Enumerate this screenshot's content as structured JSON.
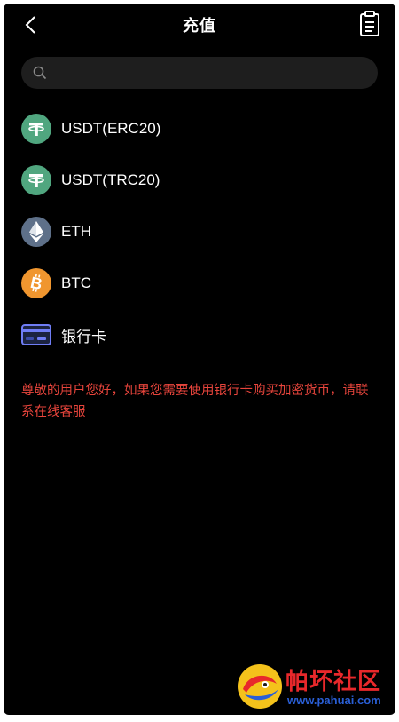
{
  "header": {
    "title": "充值",
    "back_icon": "chevron-left-icon",
    "record_icon": "clipboard-list-icon"
  },
  "search": {
    "value": "",
    "placeholder": ""
  },
  "list": {
    "items": [
      {
        "label": "USDT(ERC20)",
        "icon": "tether-icon",
        "color": "#50a67f"
      },
      {
        "label": "USDT(TRC20)",
        "icon": "tether-icon",
        "color": "#50a67f"
      },
      {
        "label": "ETH",
        "icon": "ethereum-icon",
        "color": "#5e7089"
      },
      {
        "label": "BTC",
        "icon": "bitcoin-icon",
        "color": "#f0962f"
      },
      {
        "label": "银行卡",
        "icon": "bank-card-icon",
        "color": "#6f7df5"
      }
    ]
  },
  "notice": {
    "text": "尊敬的用户您好，如果您需要使用银行卡购买加密货币，请联系在线客服"
  },
  "colors": {
    "background": "#000000",
    "notice": "#e8453c",
    "search_bg": "#1e1e1e"
  },
  "watermark": {
    "title": "帕坏社区",
    "url": "www.pahuai.com"
  }
}
